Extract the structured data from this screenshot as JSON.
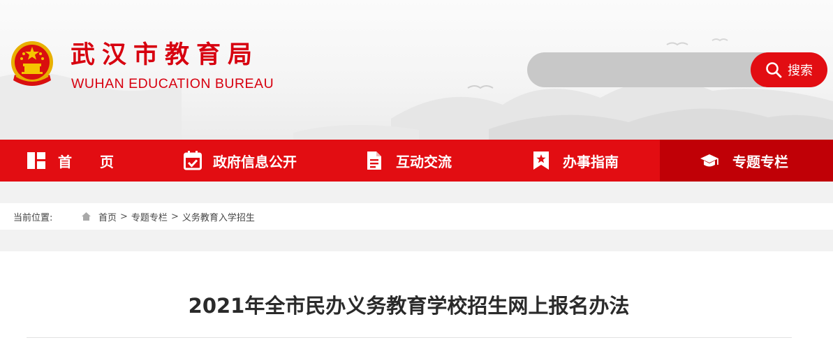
{
  "header": {
    "title_cn": "武汉市教育局",
    "title_en": "WUHAN EDUCATION BUREAU",
    "logo_icon": "national-emblem-icon"
  },
  "search": {
    "placeholder": "",
    "button_label": "搜索",
    "icon": "search-icon"
  },
  "nav": {
    "items": [
      {
        "label": "首　　页",
        "icon": "home-grid-icon",
        "active": false
      },
      {
        "label": "政府信息公开",
        "icon": "calendar-check-icon",
        "active": false
      },
      {
        "label": "互动交流",
        "icon": "document-icon",
        "active": false
      },
      {
        "label": "办事指南",
        "icon": "bookmark-star-icon",
        "active": false
      },
      {
        "label": "专题专栏",
        "icon": "graduation-cap-icon",
        "active": true
      }
    ]
  },
  "breadcrumb": {
    "label": "当前位置:",
    "icon": "home-icon",
    "items": [
      "首页",
      "专题专栏",
      "义务教育入学招生"
    ],
    "separator": ">"
  },
  "article": {
    "title": "2021年全市民办义务教育学校招生网上报名办法"
  },
  "colors": {
    "brand_red": "#e20d12",
    "active_red": "#c00006",
    "title_red": "#d7000f",
    "search_gray": "#c8c8c8"
  }
}
